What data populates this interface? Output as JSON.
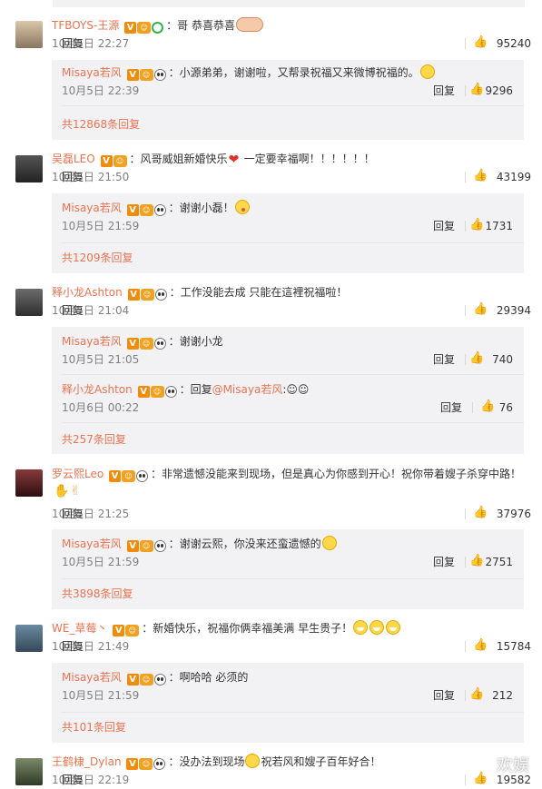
{
  "colors": {
    "accent": "#eb7350",
    "reply_bg": "#f2f2f5",
    "meta": "#808080"
  },
  "comments": [
    {
      "user": "TFBOYS-王源",
      "text": "：哥 恭喜恭喜",
      "time": "10月5日 22:27",
      "reply_label": "回复",
      "likes": "95240",
      "replies": [
        {
          "user": "Misaya若风",
          "text": "：小源弟弟，谢谢啦，又帮录祝福又来微博祝福的。",
          "time": "10月5日 22:39",
          "reply_label": "回复",
          "likes": "9296"
        }
      ],
      "more": "共12868条回复"
    },
    {
      "user": "吴磊LEO",
      "text": "：风哥威姐新婚快乐",
      "text2": "一定要幸福啊！！！！！！",
      "time": "10月5日 21:50",
      "reply_label": "回复",
      "likes": "43199",
      "replies": [
        {
          "user": "Misaya若风",
          "text": "：谢谢小磊！",
          "time": "10月5日 21:59",
          "reply_label": "回复",
          "likes": "1731"
        }
      ],
      "more": "共1209条回复"
    },
    {
      "user": "释小龙Ashton",
      "text": "：工作没能去成 只能在這裡祝福啦！",
      "time": "10月5日 21:04",
      "reply_label": "回复",
      "likes": "29394",
      "replies": [
        {
          "user": "Misaya若风",
          "text": "：谢谢小龙",
          "time": "10月5日 21:05",
          "reply_label": "回复",
          "likes": "740"
        },
        {
          "user": "释小龙Ashton",
          "text": "：回复",
          "mention": "@Misaya若风",
          "text2": ":☺☺",
          "time": "10月6日 00:22",
          "reply_label": "回复",
          "likes": "76"
        }
      ],
      "more": "共257条回复"
    },
    {
      "user": "罗云熙Leo",
      "text": "：非常遗憾没能来到现场，但是真心为你感到开心！祝你带着嫂子杀穿中路！",
      "time": "10月5日 21:25",
      "reply_label": "回复",
      "likes": "37976",
      "replies": [
        {
          "user": "Misaya若风",
          "text": "：谢谢云熙，你没来还蛮遗憾的",
          "time": "10月5日 21:59",
          "reply_label": "回复",
          "likes": "2751"
        }
      ],
      "more": "共3898条回复"
    },
    {
      "user": "WE_草莓丶",
      "text": "：新婚快乐，祝福你俩幸福美满 早生贵子！",
      "time": "10月5日 21:49",
      "reply_label": "回复",
      "likes": "15784",
      "replies": [
        {
          "user": "Misaya若风",
          "text": "：啊哈哈 必须的",
          "time": "10月5日 21:59",
          "reply_label": "回复",
          "likes": "212"
        }
      ],
      "more": "共101条回复"
    },
    {
      "user": "王鹤棣_Dylan",
      "text": "：没办法到现场",
      "text2": "祝若风和嫂子百年好合！",
      "time": "10月5日 22:19",
      "reply_label": "回复",
      "likes": "19582"
    }
  ],
  "icons": {
    "like": "thumbs-up-icon",
    "verified": "verified-v-badge",
    "level": "level-badge",
    "panda": "panda-badge"
  },
  "watermark": "欢娱"
}
